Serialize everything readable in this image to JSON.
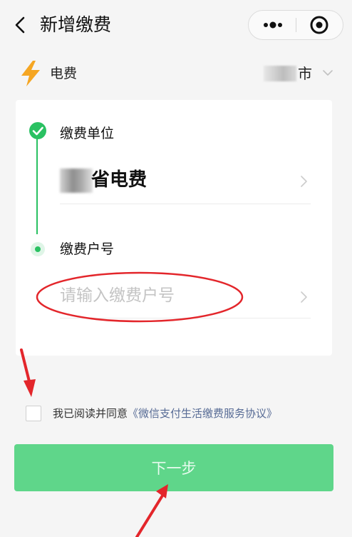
{
  "navbar": {
    "title": "新增缴费"
  },
  "category": {
    "label": "电费",
    "city": "市"
  },
  "step1": {
    "title": "缴费单位",
    "value": "省电费"
  },
  "step2": {
    "title": "缴费户号",
    "placeholder": "请输入缴费户号"
  },
  "agreement": {
    "text": "我已阅读并同意",
    "link": "《微信支付生活缴费服务协议》"
  },
  "button": {
    "next_label": "下一步"
  },
  "colors": {
    "accent_green": "#2ac162",
    "button_green": "#5fd68a",
    "link_blue": "#576b95",
    "annotation_red": "#e3262b",
    "bolt_orange": "#f5a623"
  },
  "icons": [
    "back-arrow-icon",
    "more-dots-icon",
    "close-target-icon",
    "lightning-bolt-icon",
    "chevron-down-icon",
    "check-circle-icon",
    "chevron-right-icon",
    "active-dot-icon"
  ]
}
